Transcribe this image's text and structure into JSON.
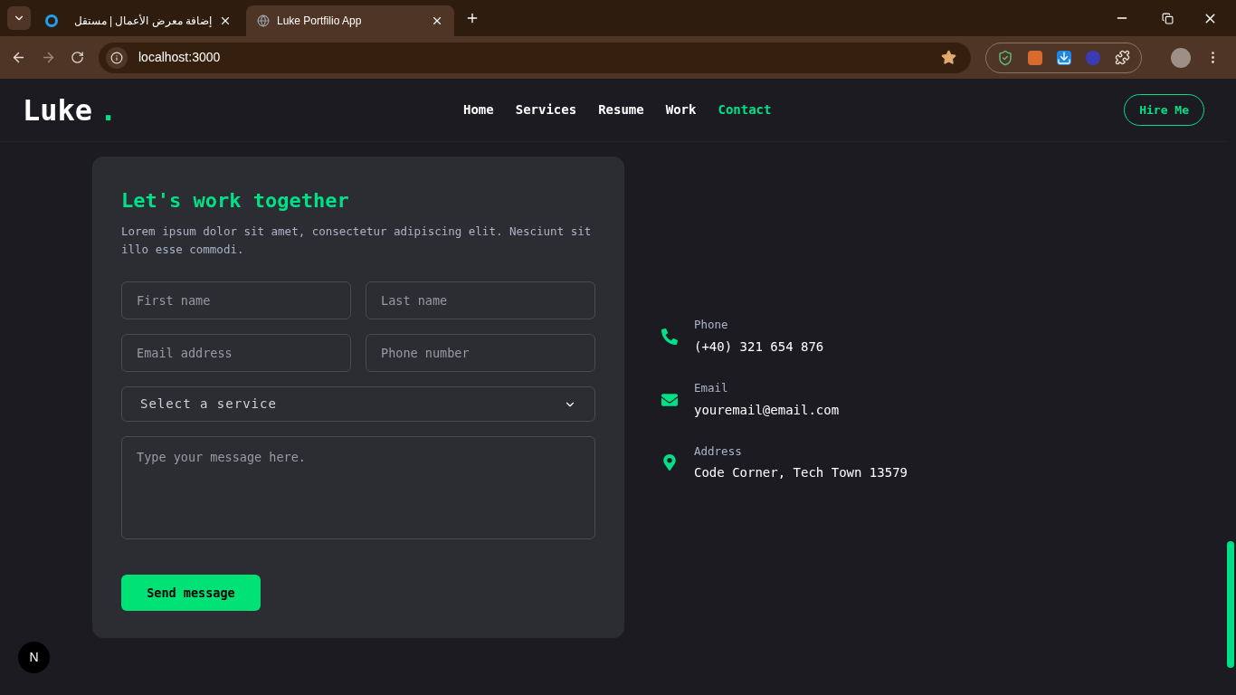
{
  "browser": {
    "tabs": [
      {
        "title": "إضافة معرض الأعمال | مستقل",
        "selected": false
      },
      {
        "title": "Luke Portfilio App",
        "selected": true
      }
    ],
    "url": "localhost:3000"
  },
  "header": {
    "logo": "Luke",
    "logo_dot": ".",
    "nav": [
      {
        "label": "Home",
        "selected": false
      },
      {
        "label": "Services",
        "selected": false
      },
      {
        "label": "Resume",
        "selected": false
      },
      {
        "label": "Work",
        "selected": false
      },
      {
        "label": "Contact",
        "selected": true
      }
    ],
    "hire_button": "Hire Me"
  },
  "form": {
    "title": "Let's work together",
    "description": "Lorem ipsum dolor sit amet, consectetur adipiscing elit. Nesciunt sit illo esse commodi.",
    "fields": [
      {
        "placeholder": "First name"
      },
      {
        "placeholder": "Last name"
      },
      {
        "placeholder": "Email address"
      },
      {
        "placeholder": "Phone number"
      }
    ],
    "service_select": "Select a service",
    "message_placeholder": "Type your message here.",
    "submit": "Send message"
  },
  "contact_info": [
    {
      "kind": "phone",
      "label": "Phone",
      "value": "(+40) 321 654 876"
    },
    {
      "kind": "email",
      "label": "Email",
      "value": "youremail@email.com"
    },
    {
      "kind": "address",
      "label": "Address",
      "value": "Code Corner, Tech Town 13579"
    }
  ],
  "dev_badge": "N"
}
